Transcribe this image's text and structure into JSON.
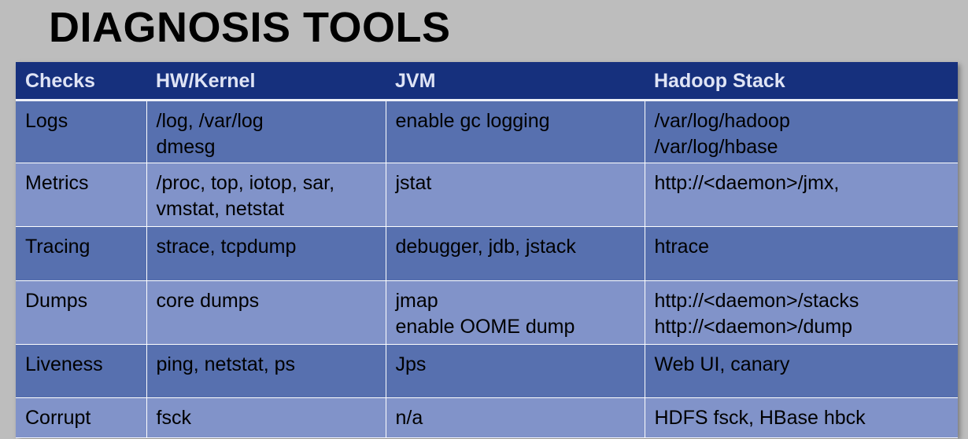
{
  "title": "DIAGNOSIS TOOLS",
  "table": {
    "headers": [
      "Checks",
      "HW/Kernel",
      "JVM",
      "Hadoop Stack"
    ],
    "rows": [
      {
        "check": "Logs",
        "hw_kernel": [
          "/log, /var/log",
          "dmesg"
        ],
        "jvm": [
          "enable gc logging"
        ],
        "hadoop": [
          "/var/log/hadoop",
          "/var/log/hbase"
        ]
      },
      {
        "check": "Metrics",
        "hw_kernel": [
          "/proc, top, iotop, sar,",
          "vmstat, netstat"
        ],
        "jvm": [
          "jstat"
        ],
        "hadoop": [
          "http://<daemon>/jmx,"
        ]
      },
      {
        "check": "Tracing",
        "hw_kernel": [
          "strace, tcpdump"
        ],
        "jvm": [
          "debugger, jdb, jstack"
        ],
        "hadoop": [
          "htrace"
        ]
      },
      {
        "check": "Dumps",
        "hw_kernel": [
          "core dumps"
        ],
        "jvm": [
          "jmap",
          "enable OOME dump"
        ],
        "hadoop": [
          "http://<daemon>/stacks",
          "http://<daemon>/dump"
        ]
      },
      {
        "check": "Liveness",
        "hw_kernel": [
          "ping, netstat, ps"
        ],
        "jvm": [
          "Jps"
        ],
        "hadoop": [
          "Web UI, canary"
        ]
      },
      {
        "check": "Corrupt",
        "hw_kernel": [
          "fsck"
        ],
        "jvm": [
          "n/a"
        ],
        "hadoop": [
          "HDFS fsck, HBase hbck"
        ]
      }
    ]
  },
  "colors": {
    "background": "#bdbdbd",
    "header_row": "#16307d",
    "row_dark": "#5770af",
    "row_light": "#8193c9"
  }
}
